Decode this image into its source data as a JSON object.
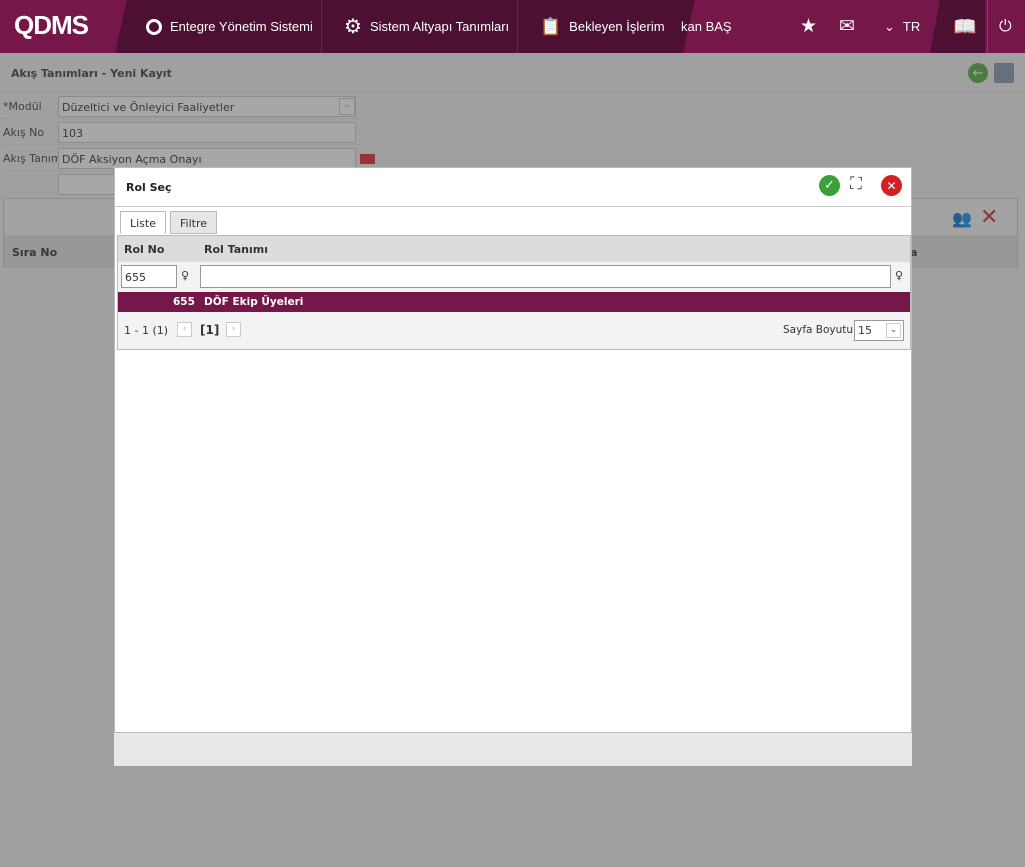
{
  "nav": {
    "logo": "QDMS",
    "items": [
      "Entegre Yönetim Sistemi",
      "Sistem Altyapı Tanımları",
      "Bekleyen İşlerim"
    ],
    "user": "kan BAŞ",
    "lang": "TR"
  },
  "page": {
    "title": "Akış Tanımları - Yeni Kayıt",
    "fields": [
      {
        "label": "*Modül",
        "value": "Düzeltici ve Önleyici Faaliyetler"
      },
      {
        "label": "Akış No",
        "value": "103"
      },
      {
        "label": "Akış Tanımı",
        "value": "DÖF Aksiyon Açma Onayı"
      }
    ],
    "grid_header": "Sıra No",
    "grid_header_right": "a"
  },
  "dialog": {
    "title": "Rol Seç",
    "tabs": [
      "Liste",
      "Filtre"
    ],
    "columns": [
      "Rol No",
      "Rol Tanımı"
    ],
    "filter": {
      "rol_no": "655",
      "rol_tanimi": ""
    },
    "rows": [
      {
        "no": "655",
        "name": "DÖF Ekip Üyeleri"
      }
    ],
    "pager": {
      "range": "1 - 1 (1)",
      "current": "[1]",
      "page_size_label": "Sayfa Boyutu:",
      "page_size": "15"
    }
  },
  "colors": {
    "brand": "#751748",
    "brand_dark": "#4e1032"
  }
}
